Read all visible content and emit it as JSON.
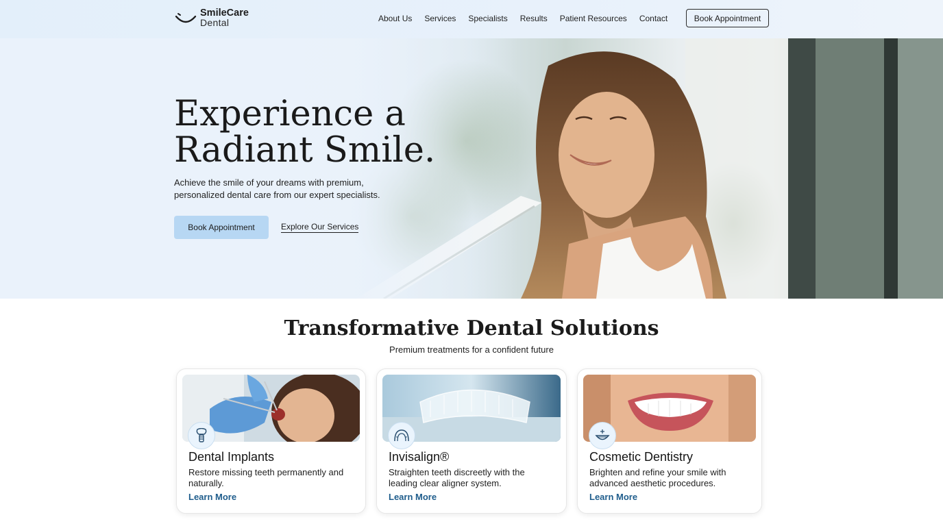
{
  "brand": {
    "name": "SmileCare",
    "sub": "Dental"
  },
  "nav": {
    "items": [
      "About Us",
      "Services",
      "Specialists",
      "Results",
      "Patient Resources",
      "Contact"
    ],
    "cta": "Book Appointment"
  },
  "hero": {
    "title_line1": "Experience a",
    "title_line2": "Radiant Smile.",
    "copy": "Achieve the smile of your dreams with premium, personalized dental care from our expert specialists.",
    "primary_button": "Book Appointment",
    "secondary_link": "Explore Our Services"
  },
  "services": {
    "title": "Transformative Dental Solutions",
    "subtitle": "Premium treatments for a confident future",
    "cards": [
      {
        "icon": "tooth-implant-icon",
        "title": "Dental Implants",
        "description": "Restore missing teeth permanently and naturally.",
        "link": "Learn More"
      },
      {
        "icon": "aligner-icon",
        "title": "Invisalign®",
        "description": "Straighten teeth discreetly with the leading clear aligner system.",
        "link": "Learn More"
      },
      {
        "icon": "smile-sparkle-icon",
        "title": "Cosmetic Dentistry",
        "description": "Brighten and refine your smile with advanced aesthetic procedures.",
        "link": "Learn More"
      }
    ]
  },
  "colors": {
    "header_bg": "#e3effa",
    "primary_button": "#b7d7f3",
    "link": "#1f5d8c"
  }
}
